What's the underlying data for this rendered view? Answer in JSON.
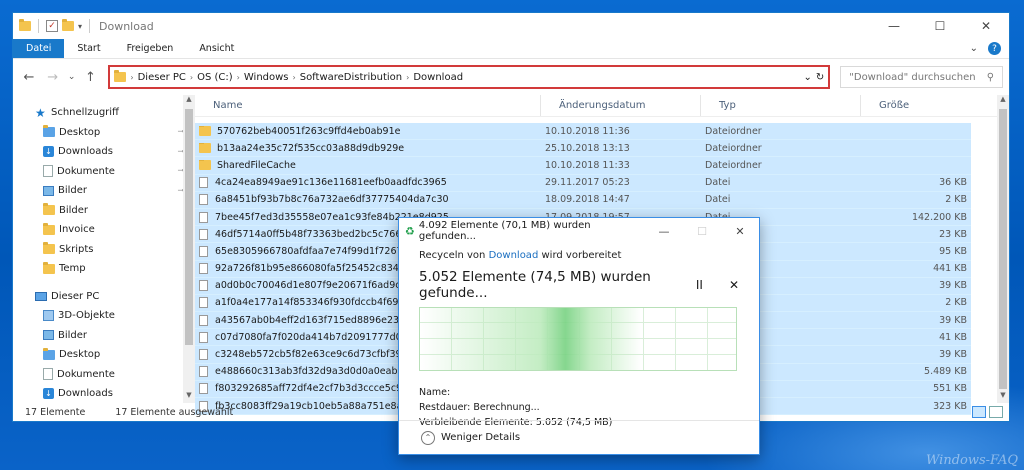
{
  "window": {
    "title": "Download",
    "minimize": "—",
    "maximize": "☐",
    "close": "✕"
  },
  "ribbon": {
    "tabs": [
      "Datei",
      "Start",
      "Freigeben",
      "Ansicht"
    ],
    "collapse": "⌄",
    "help": "?"
  },
  "nav": {
    "back": "←",
    "forward": "→",
    "recent": "⌄",
    "up": "↑",
    "breadcrumb": [
      "Dieser PC",
      "OS (C:)",
      "Windows",
      "SoftwareDistribution",
      "Download"
    ],
    "dropdown": "⌄",
    "refresh": "↻",
    "search_placeholder": "\"Download\" durchsuchen",
    "search_icon": "⚲"
  },
  "sidebar": {
    "quick_access": "Schnellzugriff",
    "quick_items": [
      {
        "label": "Desktop",
        "icon": "folder-blue",
        "pinned": true
      },
      {
        "label": "Downloads",
        "icon": "download",
        "pinned": true
      },
      {
        "label": "Dokumente",
        "icon": "document",
        "pinned": true
      },
      {
        "label": "Bilder",
        "icon": "pictures",
        "pinned": true
      },
      {
        "label": "Bilder",
        "icon": "folder",
        "pinned": false
      },
      {
        "label": "Invoice",
        "icon": "folder",
        "pinned": false
      },
      {
        "label": "Skripts",
        "icon": "folder",
        "pinned": false
      },
      {
        "label": "Temp",
        "icon": "folder",
        "pinned": false
      }
    ],
    "this_pc": "Dieser PC",
    "pc_items": [
      {
        "label": "3D-Objekte",
        "icon": "cube"
      },
      {
        "label": "Bilder",
        "icon": "pictures"
      },
      {
        "label": "Desktop",
        "icon": "folder-blue"
      },
      {
        "label": "Dokumente",
        "icon": "document"
      },
      {
        "label": "Downloads",
        "icon": "download"
      }
    ],
    "pin_glyph": "📌"
  },
  "columns": {
    "name": "Name",
    "date": "Änderungsdatum",
    "type": "Typ",
    "size": "Größe"
  },
  "files": [
    {
      "name": "570762beb40051f263c9ffd4eb0ab91e",
      "date": "10.10.2018 11:36",
      "type": "Dateiordner",
      "size": "",
      "kind": "folder"
    },
    {
      "name": "b13aa24e35c72f535cc03a88d9db929e",
      "date": "25.10.2018 13:13",
      "type": "Dateiordner",
      "size": "",
      "kind": "folder"
    },
    {
      "name": "SharedFileCache",
      "date": "10.10.2018 11:33",
      "type": "Dateiordner",
      "size": "",
      "kind": "folder"
    },
    {
      "name": "4ca24ea8949ae91c136e11681eefb0aadfdc3965",
      "date": "29.11.2017 05:23",
      "type": "Datei",
      "size": "36 KB",
      "kind": "file"
    },
    {
      "name": "6a8451bf93b7b8c76a732ae6df37775404da7c30",
      "date": "18.09.2018 14:47",
      "type": "Datei",
      "size": "2 KB",
      "kind": "file"
    },
    {
      "name": "7bee45f7ed3d35558e07ea1c93fe84b221e8d925",
      "date": "17.09.2018 19:57",
      "type": "Datei",
      "size": "142.200 KB",
      "kind": "file"
    },
    {
      "name": "46df5714a0ff5b48f73363bed2bc5c766",
      "date": "",
      "type": "",
      "size": "23 KB",
      "kind": "file"
    },
    {
      "name": "65e8305966780afdfaa7e74f99d1f7267",
      "date": "",
      "type": "",
      "size": "95 KB",
      "kind": "file"
    },
    {
      "name": "92a726f81b95e866080fa5f25452c834a",
      "date": "",
      "type": "",
      "size": "441 KB",
      "kind": "file"
    },
    {
      "name": "a0d0b0c70046d1e807f9e20671f6ad9c",
      "date": "",
      "type": "",
      "size": "39 KB",
      "kind": "file"
    },
    {
      "name": "a1f0a4e177a14f853346f930fdccb4f69c",
      "date": "",
      "type": "",
      "size": "2 KB",
      "kind": "file"
    },
    {
      "name": "a43567ab0b4eff2d163f715ed8896e23a",
      "date": "",
      "type": "",
      "size": "39 KB",
      "kind": "file"
    },
    {
      "name": "c07d7080fa7f020da414b7d2091777d0",
      "date": "",
      "type": "",
      "size": "41 KB",
      "kind": "file"
    },
    {
      "name": "c3248eb572cb5f82e63ce9c6d73cfbf39",
      "date": "",
      "type": "",
      "size": "39 KB",
      "kind": "file"
    },
    {
      "name": "e488660c313ab3fd32d9a3d0d0a0eab9",
      "date": "",
      "type": "",
      "size": "5.489 KB",
      "kind": "file"
    },
    {
      "name": "f803292685aff72df4e2cf7b3d3ccce5c9",
      "date": "",
      "type": "",
      "size": "551 KB",
      "kind": "file"
    },
    {
      "name": "fb3cc8083ff29a19cb10eb5a88a751e8a",
      "date": "",
      "type": "",
      "size": "323 KB",
      "kind": "file"
    }
  ],
  "status": {
    "count": "17 Elemente",
    "selected": "17 Elemente ausgewählt"
  },
  "dialog": {
    "title": "4.092 Elemente (70,1 MB) wurden gefunden...",
    "sub_prefix": "Recyceln von",
    "sub_link": "Download",
    "sub_suffix": "wird vorbereitet",
    "headline": "5.052 Elemente (74,5 MB) wurden gefunde...",
    "pause": "II",
    "cancel": "✕",
    "minimize": "—",
    "maximize": "☐",
    "close": "✕",
    "name_label": "Name:",
    "remaining_time_label": "Restdauer:",
    "remaining_time_value": "Berechnung...",
    "remaining_items_label": "Verbleibende Elemente:",
    "remaining_items_value": "5.052 (74,5 MB)",
    "less_details": "Weniger Details",
    "chevron": "⌃"
  },
  "watermark": "Windows-FAQ",
  "colors": {
    "accent": "#1979ca",
    "selection": "#cce8ff",
    "address_highlight": "#d23a3a",
    "progress": "#78d282"
  }
}
